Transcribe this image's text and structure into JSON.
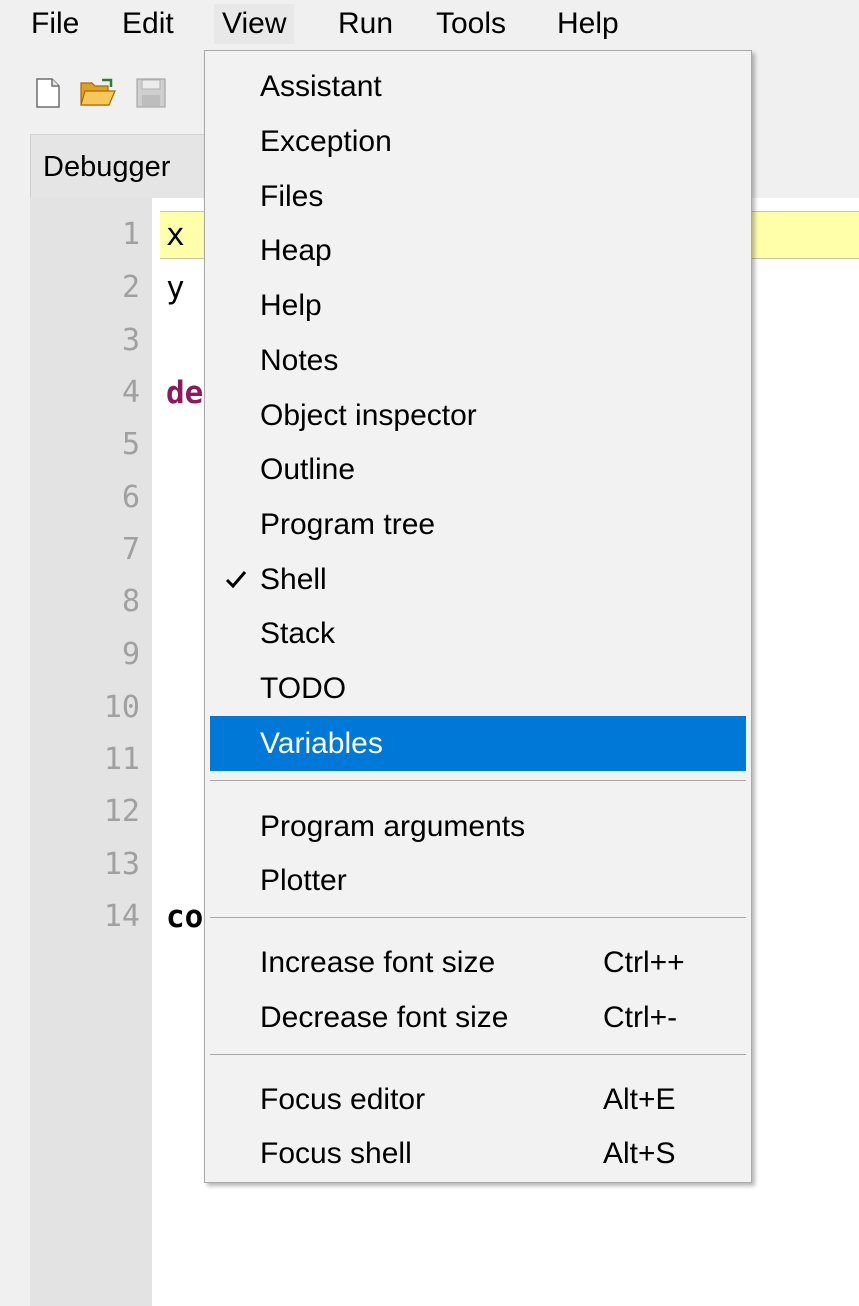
{
  "menubar": {
    "items": [
      {
        "label": "File"
      },
      {
        "label": "Edit"
      },
      {
        "label": "View"
      },
      {
        "label": "Run"
      },
      {
        "label": "Tools"
      },
      {
        "label": "Help"
      }
    ]
  },
  "toolbar": {
    "icons": [
      "new-file-icon",
      "open-folder-icon",
      "save-icon"
    ]
  },
  "tabs": [
    {
      "label": "Debugger"
    }
  ],
  "editor": {
    "line_numbers": [
      "1",
      "2",
      "3",
      "4",
      "5",
      "6",
      "7",
      "8",
      "9",
      "10",
      "11",
      "12",
      "13",
      "14"
    ],
    "code_fragments": {
      "line1": "x",
      "line2": "y",
      "line4": "de",
      "line14": "co"
    }
  },
  "view_menu": {
    "items": [
      {
        "label": "Assistant"
      },
      {
        "label": "Exception"
      },
      {
        "label": "Files"
      },
      {
        "label": "Heap"
      },
      {
        "label": "Help"
      },
      {
        "label": "Notes"
      },
      {
        "label": "Object inspector"
      },
      {
        "label": "Outline"
      },
      {
        "label": "Program tree"
      },
      {
        "label": "Shell",
        "checked": true
      },
      {
        "label": "Stack"
      },
      {
        "label": "TODO"
      },
      {
        "label": "Variables",
        "highlighted": true
      },
      {
        "label": "Program arguments"
      },
      {
        "label": "Plotter"
      },
      {
        "label": "Increase font size",
        "shortcut": "Ctrl++"
      },
      {
        "label": "Decrease font size",
        "shortcut": "Ctrl+-"
      },
      {
        "label": "Focus editor",
        "shortcut": "Alt+E"
      },
      {
        "label": "Focus shell",
        "shortcut": "Alt+S"
      }
    ]
  },
  "colors": {
    "highlight": "#0078d7",
    "current_line": "#ffffaa",
    "keyword": "#8b1a5a"
  }
}
